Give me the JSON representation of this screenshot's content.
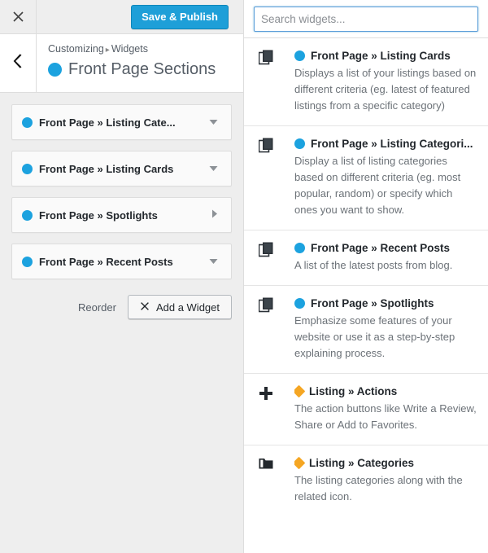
{
  "colors": {
    "accent_blue": "#1ca2df",
    "save_button_blue": "#1e9fd8",
    "accent_orange": "#f5a623",
    "panel_bg": "#eeeeee",
    "text_dark": "#23282d",
    "text_muted": "#6c7278",
    "focus_border": "#5b9dd9"
  },
  "customizer": {
    "close_icon": "close-icon",
    "save_label": "Save & Publish",
    "back_icon": "chevron-left-icon",
    "breadcrumb": {
      "root": "Customizing",
      "separator": "▸",
      "current": "Widgets"
    },
    "panel_title": "Front Page Sections",
    "sections": [
      {
        "label": "Front Page » Listing Cate...",
        "caret": "chevron-down-icon",
        "expanded": false
      },
      {
        "label": "Front Page » Listing Cards",
        "caret": "chevron-down-icon",
        "expanded": false
      },
      {
        "label": "Front Page » Spotlights",
        "caret": "chevron-right-icon",
        "expanded": false
      },
      {
        "label": "Front Page » Recent Posts",
        "caret": "chevron-down-icon",
        "expanded": false
      }
    ],
    "footer": {
      "reorder_label": "Reorder",
      "add_widget_label": "Add a Widget",
      "add_widget_icon": "close-x-icon"
    }
  },
  "widgets_panel": {
    "search": {
      "placeholder": "Search widgets...",
      "value": ""
    },
    "available_widgets": [
      {
        "icon": "copy-pages-icon",
        "marker": "dot-blue",
        "title": "Front Page » Listing Cards",
        "description": "Displays a list of your listings based on different criteria (eg. latest of featured listings from a specific category)"
      },
      {
        "icon": "copy-pages-icon",
        "marker": "dot-blue",
        "title": "Front Page » Listing Categori...",
        "description": "Display a list of listing categories based on different criteria (eg. most popular, random) or specify which ones you want to show."
      },
      {
        "icon": "copy-pages-icon",
        "marker": "dot-blue",
        "title": "Front Page » Recent Posts",
        "description": "A list of the latest posts from blog."
      },
      {
        "icon": "copy-pages-icon",
        "marker": "dot-blue",
        "title": "Front Page » Spotlights",
        "description": "Emphasize some features of your website or use it as a step-by-step explaining process."
      },
      {
        "icon": "plus-icon",
        "marker": "diamond-orange",
        "title": "Listing » Actions",
        "description": "The action buttons like Write a Review, Share or Add to Favorites."
      },
      {
        "icon": "folder-icon",
        "marker": "diamond-orange",
        "title": "Listing » Categories",
        "description": "The listing categories along with the related icon."
      }
    ]
  }
}
